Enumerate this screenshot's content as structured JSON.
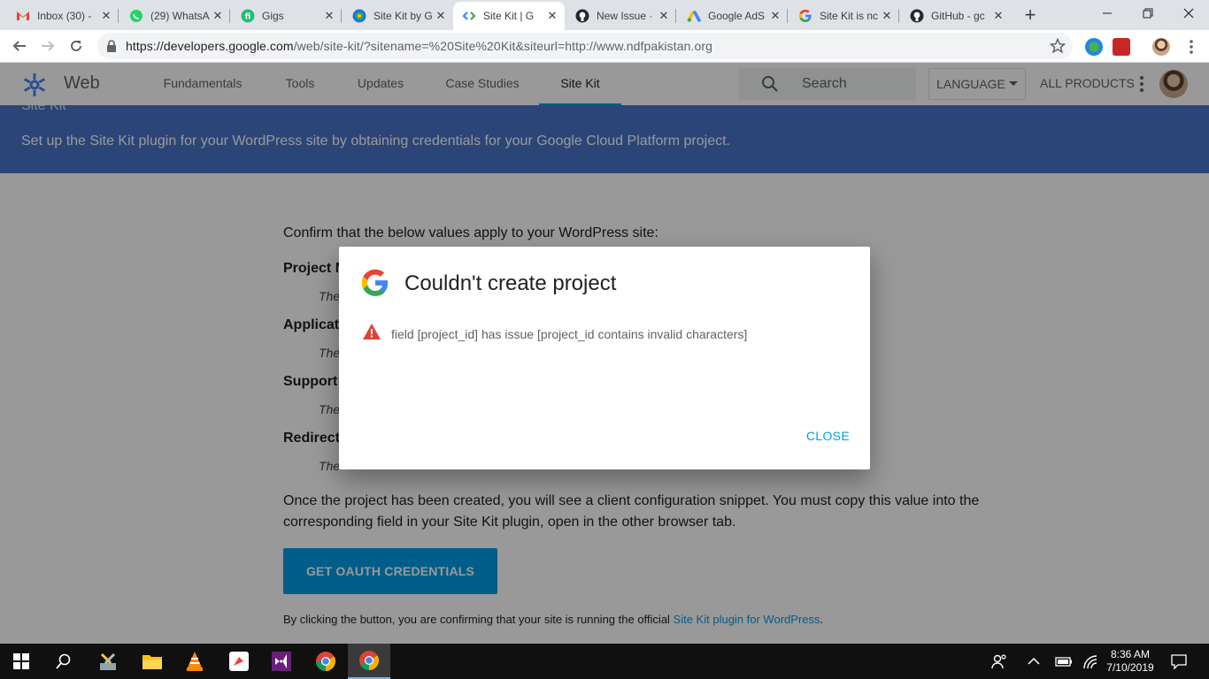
{
  "browser": {
    "tabs": [
      {
        "title": "Inbox (30) -",
        "icon": "gmail-icon"
      },
      {
        "title": "(29) WhatsA",
        "icon": "whatsapp-icon"
      },
      {
        "title": "Gigs",
        "icon": "fiverr-icon"
      },
      {
        "title": "Site Kit by G",
        "icon": "sitekit-icon"
      },
      {
        "title": "Site Kit | G",
        "icon": "google-dev-icon",
        "active": true
      },
      {
        "title": "New Issue ·",
        "icon": "github-icon"
      },
      {
        "title": "Google AdS",
        "icon": "google-ads-icon"
      },
      {
        "title": "Site Kit is nc",
        "icon": "google-icon"
      },
      {
        "title": "GitHub - gc",
        "icon": "github-icon"
      }
    ],
    "url_host": "https://developers.google.com",
    "url_rest": "/web/site-kit/?sitename=%20Site%20Kit&siteurl=http://www.ndfpakistan.org"
  },
  "site": {
    "name": "Web",
    "nav": [
      "Fundamentals",
      "Tools",
      "Updates",
      "Case Studies",
      "Site Kit"
    ],
    "active_nav": "Site Kit",
    "search_placeholder": "Search",
    "language_label": "LANGUAGE",
    "all_products_label": "ALL PRODUCTS"
  },
  "banner": {
    "title_fragment": "Site Kit",
    "text": "Set up the Site Kit plugin for your WordPress site by obtaining credentials for your Google Cloud Platform project."
  },
  "content": {
    "confirm_text": "Confirm that the below values apply to your WordPress site:",
    "fields": [
      {
        "label": "Project N",
        "help": "The"
      },
      {
        "label": "Applicati",
        "help": "The"
      },
      {
        "label": "Support",
        "help": "The"
      },
      {
        "label": "Redirect",
        "help": "The"
      }
    ],
    "once_text": "Once the project has been created, you will see a client configuration snippet. You must copy this value into the corresponding field in your Site Kit plugin, open in the other browser tab.",
    "oauth_button": "GET OAUTH CREDENTIALS",
    "footnote_prefix": "By clicking the button, you are confirming that your site is running the official ",
    "footnote_link": "Site Kit plugin for WordPress",
    "footnote_suffix": "."
  },
  "dialog": {
    "title": "Couldn't create project",
    "message": "field [project_id] has issue [project_id contains invalid characters]",
    "close_label": "CLOSE"
  },
  "taskbar": {
    "time": "8:36 AM",
    "date": "7/10/2019"
  },
  "colors": {
    "banner": "#4a74c9",
    "accent": "#039be5",
    "warning": "#db4437"
  }
}
